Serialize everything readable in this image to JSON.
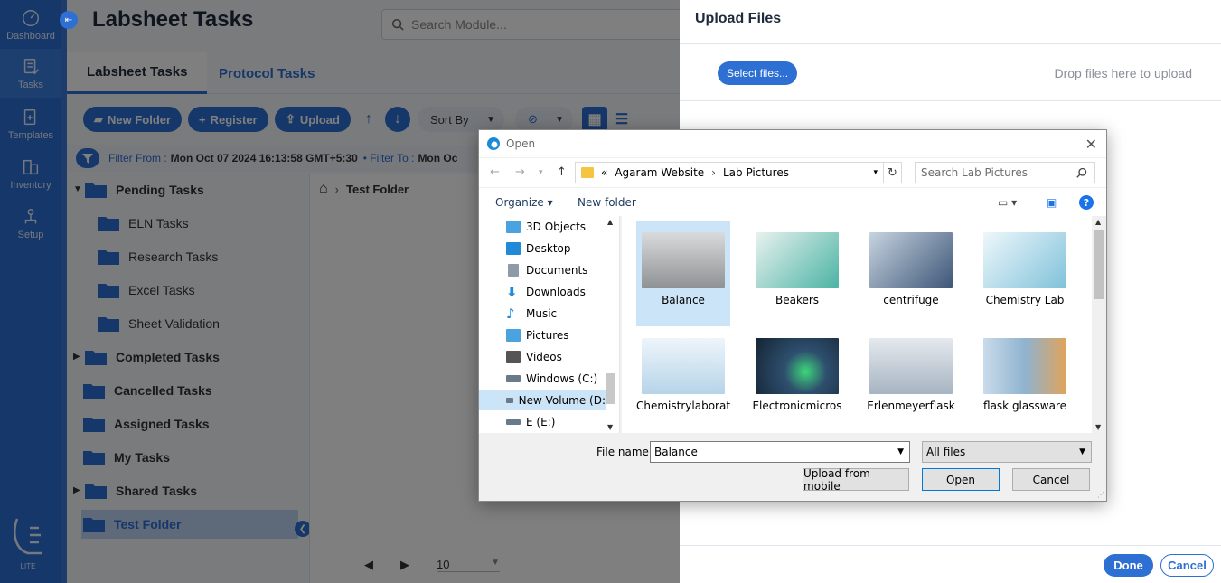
{
  "sidebar": {
    "items": [
      {
        "label": "Dashboard",
        "icon": "gauge-icon"
      },
      {
        "label": "Tasks",
        "icon": "tasks-icon"
      },
      {
        "label": "Templates",
        "icon": "template-icon"
      },
      {
        "label": "Inventory",
        "icon": "inventory-icon"
      },
      {
        "label": "Setup",
        "icon": "setup-icon"
      }
    ],
    "logo_text": "LITE"
  },
  "header": {
    "title": "Labsheet Tasks",
    "search_placeholder": "Search Module..."
  },
  "tabs": [
    {
      "label": "Labsheet Tasks",
      "active": true
    },
    {
      "label": "Protocol Tasks",
      "active": false
    }
  ],
  "toolbar": {
    "new_folder": "New Folder",
    "register": "Register",
    "upload": "Upload",
    "sort_by": "Sort By"
  },
  "filter": {
    "from_label": "Filter From :",
    "from_value": "Mon Oct 07 2024 16:13:58 GMT+5:30",
    "to_label": "• Filter To :",
    "to_value": "Mon Oc"
  },
  "tree": {
    "pending": "Pending Tasks",
    "eln": "ELN Tasks",
    "research": "Research Tasks",
    "excel": "Excel Tasks",
    "sheet": "Sheet Validation",
    "completed": "Completed Tasks",
    "cancelled": "Cancelled Tasks",
    "assigned": "Assigned Tasks",
    "my": "My Tasks",
    "shared": "Shared Tasks",
    "test": "Test Folder"
  },
  "content": {
    "breadcrumb": "Test Folder",
    "page_size": "10"
  },
  "upload": {
    "title": "Upload Files",
    "select_label": "Select files...",
    "drop_text": "Drop files here to upload",
    "done_label": "Done",
    "cancel_label": "Cancel"
  },
  "dialog": {
    "title": "Open",
    "path": {
      "prefix": "«",
      "segment1": "Agaram Website",
      "segment2": "Lab Pictures"
    },
    "search_placeholder": "Search Lab Pictures",
    "organize": "Organize ▾",
    "new_folder": "New folder",
    "nav": [
      {
        "label": "3D Objects",
        "color": "#4aa3df"
      },
      {
        "label": "Desktop",
        "color": "#1f8ad6"
      },
      {
        "label": "Documents",
        "color": "#8f9aa8"
      },
      {
        "label": "Downloads",
        "color": "#1f8ad6"
      },
      {
        "label": "Music",
        "color": "#1f8ad6"
      },
      {
        "label": "Pictures",
        "color": "#4aa3df"
      },
      {
        "label": "Videos",
        "color": "#555555"
      },
      {
        "label": "Windows (C:)",
        "color": "#6b7a8a"
      },
      {
        "label": "New Volume (D:",
        "color": "#6b7a8a"
      },
      {
        "label": "E (E:)",
        "color": "#6b7a8a"
      }
    ],
    "files": [
      {
        "name": "Balance",
        "color": "#a7a9ab",
        "selected": true
      },
      {
        "name": "Beakers",
        "color": "#4bb3a4",
        "selected": false
      },
      {
        "name": "centrifuge",
        "color": "#6f8db3",
        "selected": false
      },
      {
        "name": "Chemistry Lab",
        "color": "#7fc2d9",
        "selected": false
      },
      {
        "name": "Chemistrylaborat",
        "color": "#b6d4e8",
        "selected": false
      },
      {
        "name": "Electronicmicros",
        "color": "#2e4f6e",
        "selected": false
      },
      {
        "name": "Erlenmeyerflask",
        "color": "#c5ced8",
        "selected": false
      },
      {
        "name": "flask glassware",
        "color": "#8fb3d0",
        "selected": false
      }
    ],
    "file_name_label": "File name:",
    "file_name_value": "Balance",
    "filter_value": "All files",
    "upload_mobile": "Upload from mobile",
    "open": "Open",
    "cancel": "Cancel"
  }
}
